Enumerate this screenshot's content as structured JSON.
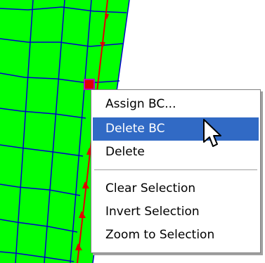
{
  "colors": {
    "mesh_fill": "#00ff00",
    "mesh_lines": "#0000c8",
    "boundary_line": "#e00000",
    "selection_marker": "#c000c0",
    "menu_highlight": "#316ac5"
  },
  "canvas": {
    "icon": "mesh-grid"
  },
  "context_menu": {
    "items": [
      {
        "label": "Assign BC..."
      },
      {
        "label": "Delete BC"
      },
      {
        "label": "Delete"
      },
      {
        "label": "Clear Selection"
      },
      {
        "label": "Invert Selection"
      },
      {
        "label": "Zoom to Selection"
      }
    ],
    "highlighted_index": 1
  },
  "cursor": {
    "icon": "arrow-pointer"
  }
}
